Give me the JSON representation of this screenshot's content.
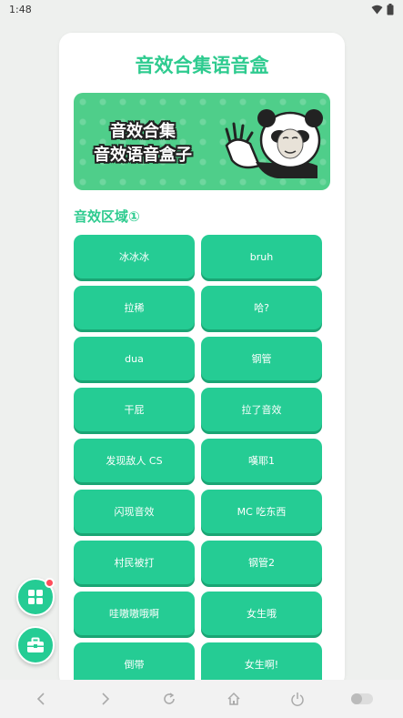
{
  "status_bar": {
    "time": "1:48",
    "icons": [
      "wifi-icon",
      "battery-icon"
    ]
  },
  "card": {
    "title": "音效合集语音盒",
    "banner": {
      "line1": "音效合集",
      "line2": "音效语音盒子"
    },
    "section_title": "音效区域①",
    "buttons": [
      {
        "label": "冰冰冰"
      },
      {
        "label": "bruh"
      },
      {
        "label": "拉稀"
      },
      {
        "label": "哈?"
      },
      {
        "label": "dua"
      },
      {
        "label": "钢管"
      },
      {
        "label": "干屁"
      },
      {
        "label": "拉了音效"
      },
      {
        "label": "发现敌人 CS"
      },
      {
        "label": "嘆耶1"
      },
      {
        "label": "闪现音效"
      },
      {
        "label": "MC 吃东西"
      },
      {
        "label": "村民被打"
      },
      {
        "label": "钢管2"
      },
      {
        "label": "哇嗷嗷哦啊"
      },
      {
        "label": "女生哦"
      },
      {
        "label": "倒带"
      },
      {
        "label": "女生啊!"
      }
    ]
  },
  "fabs": {
    "apps": "grid-icon",
    "toolbox": "toolbox-icon"
  },
  "nav_bar": {
    "icons": [
      "back-icon",
      "forward-icon",
      "refresh-icon",
      "home-icon",
      "power-icon",
      "toggle-icon"
    ]
  },
  "colors": {
    "accent": "#25cc94",
    "title": "#2ecb8f",
    "badge": "#ff4d5b"
  }
}
